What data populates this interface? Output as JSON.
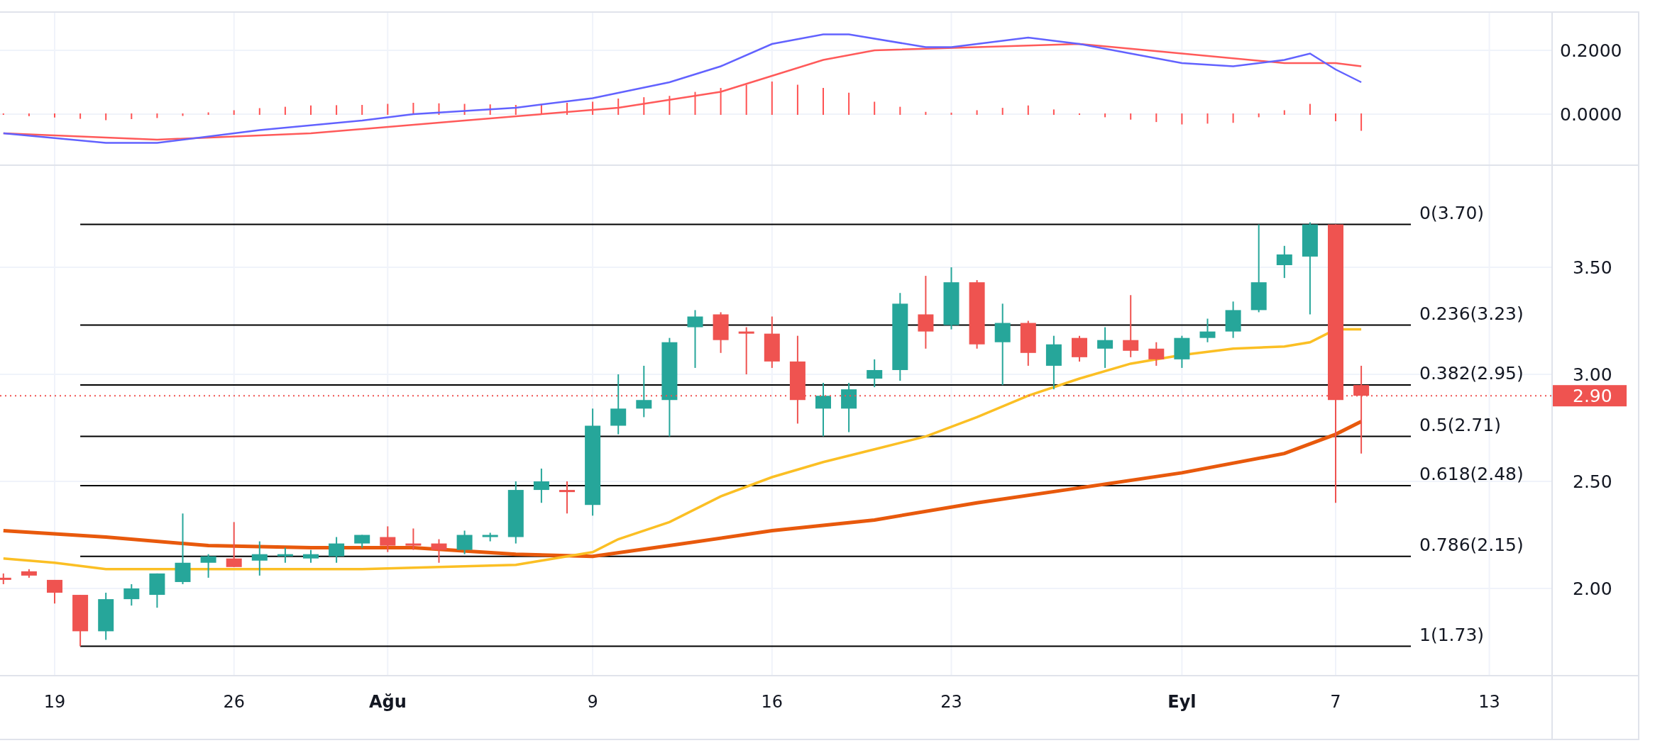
{
  "macd_pane": {
    "axis_labels": [
      "0.2000",
      "0.0000"
    ]
  },
  "price_pane": {
    "fib_levels": [
      {
        "label": "0(3.70)"
      },
      {
        "label": "0.236(3.23)"
      },
      {
        "label": "0.382(2.95)"
      },
      {
        "label": "0.5(2.71)"
      },
      {
        "label": "0.618(2.48)"
      },
      {
        "label": "0.786(2.15)"
      },
      {
        "label": "1(1.73)"
      }
    ],
    "axis_labels": [
      "3.50",
      "3.00",
      "2.50",
      "2.00"
    ],
    "last_price": "2.90"
  },
  "time_axis": {
    "labels": [
      {
        "text": "19",
        "kind": "day"
      },
      {
        "text": "26",
        "kind": "day"
      },
      {
        "text": "Ağu",
        "kind": "month"
      },
      {
        "text": "9",
        "kind": "day"
      },
      {
        "text": "16",
        "kind": "day"
      },
      {
        "text": "23",
        "kind": "day"
      },
      {
        "text": "Eyl",
        "kind": "month"
      },
      {
        "text": "7",
        "kind": "day"
      },
      {
        "text": "13",
        "kind": "day"
      }
    ]
  }
}
